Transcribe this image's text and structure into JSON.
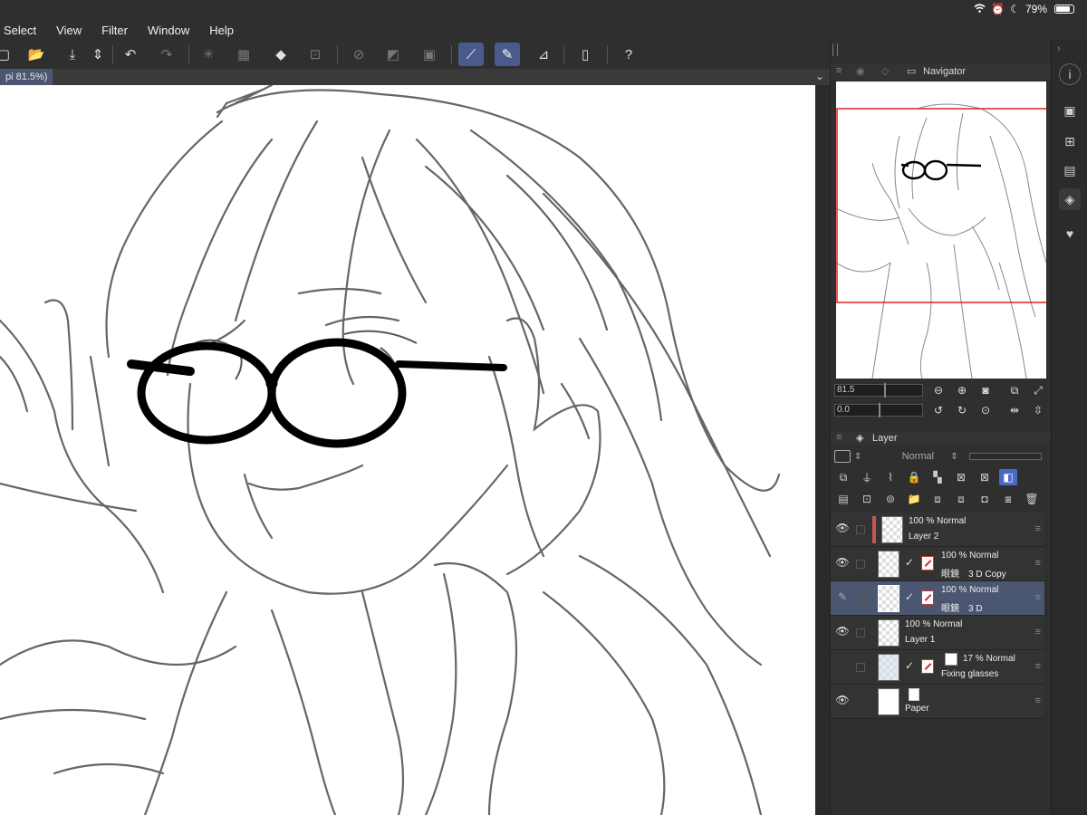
{
  "status": {
    "battery": "79%",
    "battery_level": 0.79
  },
  "menu": [
    "Select",
    "View",
    "Filter",
    "Window",
    "Help"
  ],
  "doc_tab": "pi 81.5%)",
  "navigator": {
    "tab_label": "Navigator",
    "zoom_value": "81.5",
    "rotate_value": "0.0"
  },
  "layer_panel": {
    "tab_label": "Layer",
    "blend_mode": "Normal"
  },
  "layers": [
    {
      "opacity_mode": "100 % Normal",
      "name": "Layer 2"
    },
    {
      "opacity_mode": "100 % Normal",
      "name": "眼鏡　3 D Copy"
    },
    {
      "opacity_mode": "100 % Normal",
      "name": "眼鏡　3 D"
    },
    {
      "opacity_mode": "100 % Normal",
      "name": "Layer 1"
    },
    {
      "opacity_mode": "17 % Normal",
      "name": "Fixing glasses"
    },
    {
      "opacity_mode": "",
      "name": "Paper"
    }
  ],
  "icons": {
    "wifi": "wifi-icon",
    "alarm": "alarm-icon",
    "moon": "moon-icon",
    "undo": "undo-icon",
    "redo": "redo-icon",
    "help": "help-icon"
  }
}
